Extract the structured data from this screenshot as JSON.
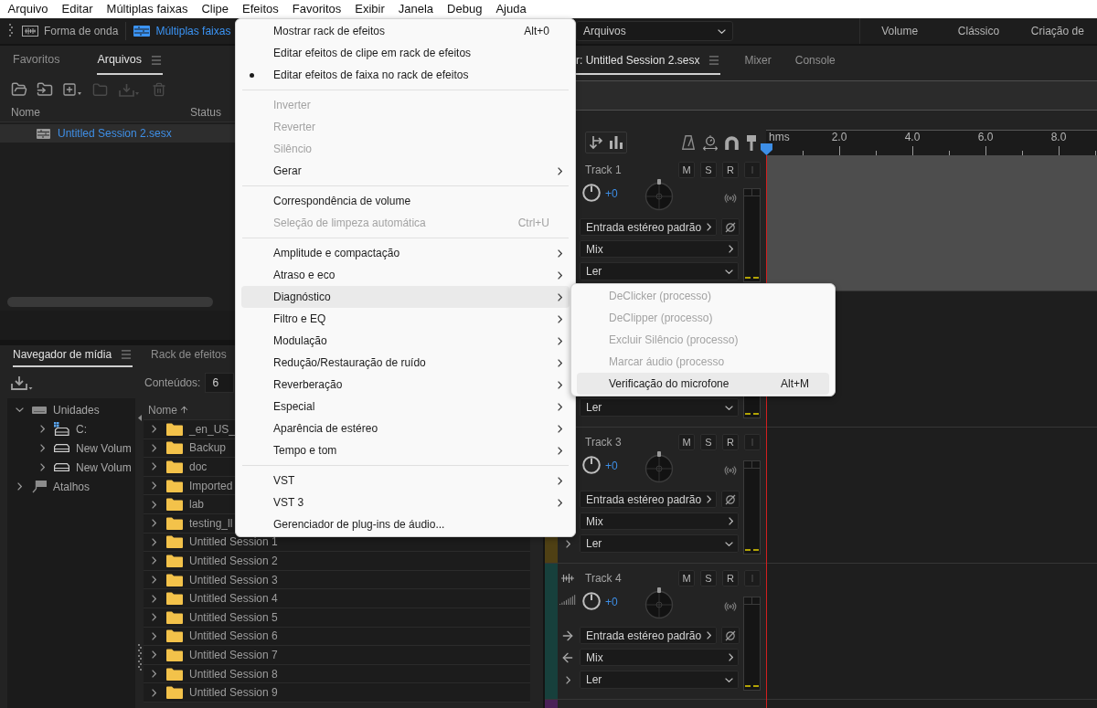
{
  "menubar": [
    "Arquivo",
    "Editar",
    "Múltiplas faixas",
    "Clipe",
    "Efeitos",
    "Favoritos",
    "Exibir",
    "Janela",
    "Debug",
    "Ajuda"
  ],
  "workspace_bar": {
    "modes": [
      {
        "label": "Forma de onda",
        "kind": "waveform",
        "selected": false
      },
      {
        "label": "Múltiplas faixas",
        "kind": "multitrack",
        "selected": true
      }
    ],
    "workspace": "Arquivos",
    "workspaces": [
      "Volume",
      "Clássico",
      "Criação de"
    ]
  },
  "files_panel": {
    "tabs": [
      {
        "label": "Favoritos",
        "selected": false
      },
      {
        "label": "Arquivos",
        "selected": true
      }
    ],
    "columns": [
      "Nome",
      "Status"
    ],
    "rows": [
      {
        "name": "Untitled Session 2.sesx",
        "selected": true
      }
    ]
  },
  "media_browser": {
    "tabs": [
      {
        "label": "Navegador de mídia",
        "selected": true
      },
      {
        "label": "Rack de efeitos",
        "selected": false
      }
    ],
    "contents_label": "Conteúdos:",
    "contents_value": "6",
    "tree": [
      {
        "label": "Unidades",
        "kind": "drives",
        "expanded": true,
        "children": [
          {
            "label": "C:",
            "kind": "system",
            "expanded": false
          },
          {
            "label": "New Volum",
            "kind": "volume",
            "expanded": false
          },
          {
            "label": "New Volum",
            "kind": "volume",
            "expanded": false
          }
        ]
      },
      {
        "label": "Atalhos",
        "kind": "shortcuts",
        "expanded": false
      }
    ],
    "column": "Nome",
    "rows": [
      {
        "name": "_en_US_",
        "expanded": false
      },
      {
        "name": "Backup",
        "expanded": false
      },
      {
        "name": "doc",
        "expanded": false
      },
      {
        "name": "Imported",
        "expanded": false
      },
      {
        "name": "lab",
        "expanded": false
      },
      {
        "name": "testing_ll",
        "expanded": false
      },
      {
        "name": "Untitled Session 1",
        "expanded": false
      },
      {
        "name": "Untitled Session 2",
        "expanded": false
      },
      {
        "name": "Untitled Session 3",
        "expanded": false
      },
      {
        "name": "Untitled Session 4",
        "expanded": false
      },
      {
        "name": "Untitled Session 5",
        "expanded": false
      },
      {
        "name": "Untitled Session 6",
        "expanded": false
      },
      {
        "name": "Untitled Session 7",
        "expanded": false
      },
      {
        "name": "Untitled Session 8",
        "expanded": false
      },
      {
        "name": "Untitled Session 9",
        "expanded": false
      }
    ]
  },
  "editor": {
    "tabs": [
      {
        "label": "r: Untitled Session 2.sesx",
        "selected": true
      },
      {
        "label": "Mixer",
        "selected": false
      },
      {
        "label": "Console",
        "selected": false
      }
    ],
    "ruler": {
      "unit": "hms",
      "labels": [
        "2.0",
        "4.0",
        "6.0",
        "8.0"
      ]
    },
    "tracks": [
      {
        "name": "Track 1",
        "buttons": [
          {
            "label": "M",
            "disabled": false
          },
          {
            "label": "S",
            "disabled": false
          },
          {
            "label": "R",
            "disabled": false
          },
          {
            "label": "I",
            "disabled": true
          }
        ],
        "volume": "+0",
        "input": "Entrada estéreo padrão",
        "output": "Mix",
        "automation": "Ler",
        "selected": true
      },
      {
        "automation": "Ler",
        "selected": false
      },
      {
        "name": "Track 3",
        "buttons": [
          {
            "label": "M",
            "disabled": false
          },
          {
            "label": "S",
            "disabled": false
          },
          {
            "label": "R",
            "disabled": false
          },
          {
            "label": "I",
            "disabled": true
          }
        ],
        "volume": "+0",
        "input": "Entrada estéreo padrão",
        "output": "Mix",
        "automation": "Ler",
        "color": "#4f4014",
        "selected": false
      },
      {
        "name": "Track 4",
        "buttons": [
          {
            "label": "M",
            "disabled": false
          },
          {
            "label": "S",
            "disabled": false
          },
          {
            "label": "R",
            "disabled": false
          },
          {
            "label": "I",
            "disabled": true
          }
        ],
        "volume": "+0",
        "input": "Entrada estéreo padrão",
        "output": "Mix",
        "automation": "Ler",
        "color": "#17403c",
        "selected": false
      },
      {
        "color": "#4a2057",
        "selected": false
      }
    ]
  },
  "effects_menu": {
    "items": [
      {
        "kind": "item",
        "label": "Mostrar rack de efeitos",
        "shortcut": "Alt+0",
        "checked": false,
        "disabled": false,
        "arrow": false,
        "selected": false
      },
      {
        "kind": "item",
        "label": "Editar efeitos de clipe em rack de efeitos",
        "checked": false,
        "disabled": false,
        "arrow": false,
        "selected": false
      },
      {
        "kind": "item",
        "label": "Editar efeitos de faixa no rack de efeitos",
        "checked": true,
        "disabled": false,
        "arrow": false,
        "selected": false
      },
      {
        "kind": "separator"
      },
      {
        "kind": "item",
        "label": "Inverter",
        "checked": false,
        "disabled": true,
        "arrow": false,
        "selected": false
      },
      {
        "kind": "item",
        "label": "Reverter",
        "checked": false,
        "disabled": true,
        "arrow": false,
        "selected": false
      },
      {
        "kind": "item",
        "label": "Silêncio",
        "checked": false,
        "disabled": true,
        "arrow": false,
        "selected": false
      },
      {
        "kind": "item",
        "label": "Gerar",
        "checked": false,
        "disabled": false,
        "arrow": true,
        "selected": false
      },
      {
        "kind": "separator"
      },
      {
        "kind": "item",
        "label": "Correspondência de volume",
        "checked": false,
        "disabled": false,
        "arrow": false,
        "selected": false
      },
      {
        "kind": "item",
        "label": "Seleção de limpeza automática",
        "shortcut": "Ctrl+U",
        "checked": false,
        "disabled": true,
        "arrow": false,
        "selected": false
      },
      {
        "kind": "separator"
      },
      {
        "kind": "item",
        "label": "Amplitude e compactação",
        "checked": false,
        "disabled": false,
        "arrow": true,
        "selected": false
      },
      {
        "kind": "item",
        "label": "Atraso e eco",
        "checked": false,
        "disabled": false,
        "arrow": true,
        "selected": false
      },
      {
        "kind": "item",
        "label": "Diagnóstico",
        "checked": false,
        "disabled": false,
        "arrow": true,
        "selected": true,
        "submenu": [
          {
            "label": "DeClicker (processo)",
            "disabled": true,
            "selected": false
          },
          {
            "label": "DeClipper (processo)",
            "disabled": true,
            "selected": false
          },
          {
            "label": "Excluir Silêncio (processo)",
            "disabled": true,
            "selected": false
          },
          {
            "label": "Marcar áudio (processo",
            "disabled": true,
            "selected": false
          },
          {
            "label": "Verificação do microfone",
            "shortcut": "Alt+M",
            "disabled": false,
            "selected": true
          }
        ]
      },
      {
        "kind": "item",
        "label": "Filtro e EQ",
        "checked": false,
        "disabled": false,
        "arrow": true,
        "selected": false
      },
      {
        "kind": "item",
        "label": "Modulação",
        "checked": false,
        "disabled": false,
        "arrow": true,
        "selected": false
      },
      {
        "kind": "item",
        "label": "Redução/Restauração de ruído",
        "checked": false,
        "disabled": false,
        "arrow": true,
        "selected": false
      },
      {
        "kind": "item",
        "label": "Reverberação",
        "checked": false,
        "disabled": false,
        "arrow": true,
        "selected": false
      },
      {
        "kind": "item",
        "label": "Especial",
        "checked": false,
        "disabled": false,
        "arrow": true,
        "selected": false
      },
      {
        "kind": "item",
        "label": "Aparência de estéreo",
        "checked": false,
        "disabled": false,
        "arrow": true,
        "selected": false
      },
      {
        "kind": "item",
        "label": "Tempo e tom",
        "checked": false,
        "disabled": false,
        "arrow": true,
        "selected": false
      },
      {
        "kind": "separator"
      },
      {
        "kind": "item",
        "label": "VST",
        "checked": false,
        "disabled": false,
        "arrow": true,
        "selected": false
      },
      {
        "kind": "item",
        "label": "VST 3",
        "checked": false,
        "disabled": false,
        "arrow": true,
        "selected": false
      },
      {
        "kind": "item",
        "label": "Gerenciador de plug-ins de áudio...",
        "checked": false,
        "disabled": false,
        "arrow": false,
        "selected": false
      }
    ]
  }
}
